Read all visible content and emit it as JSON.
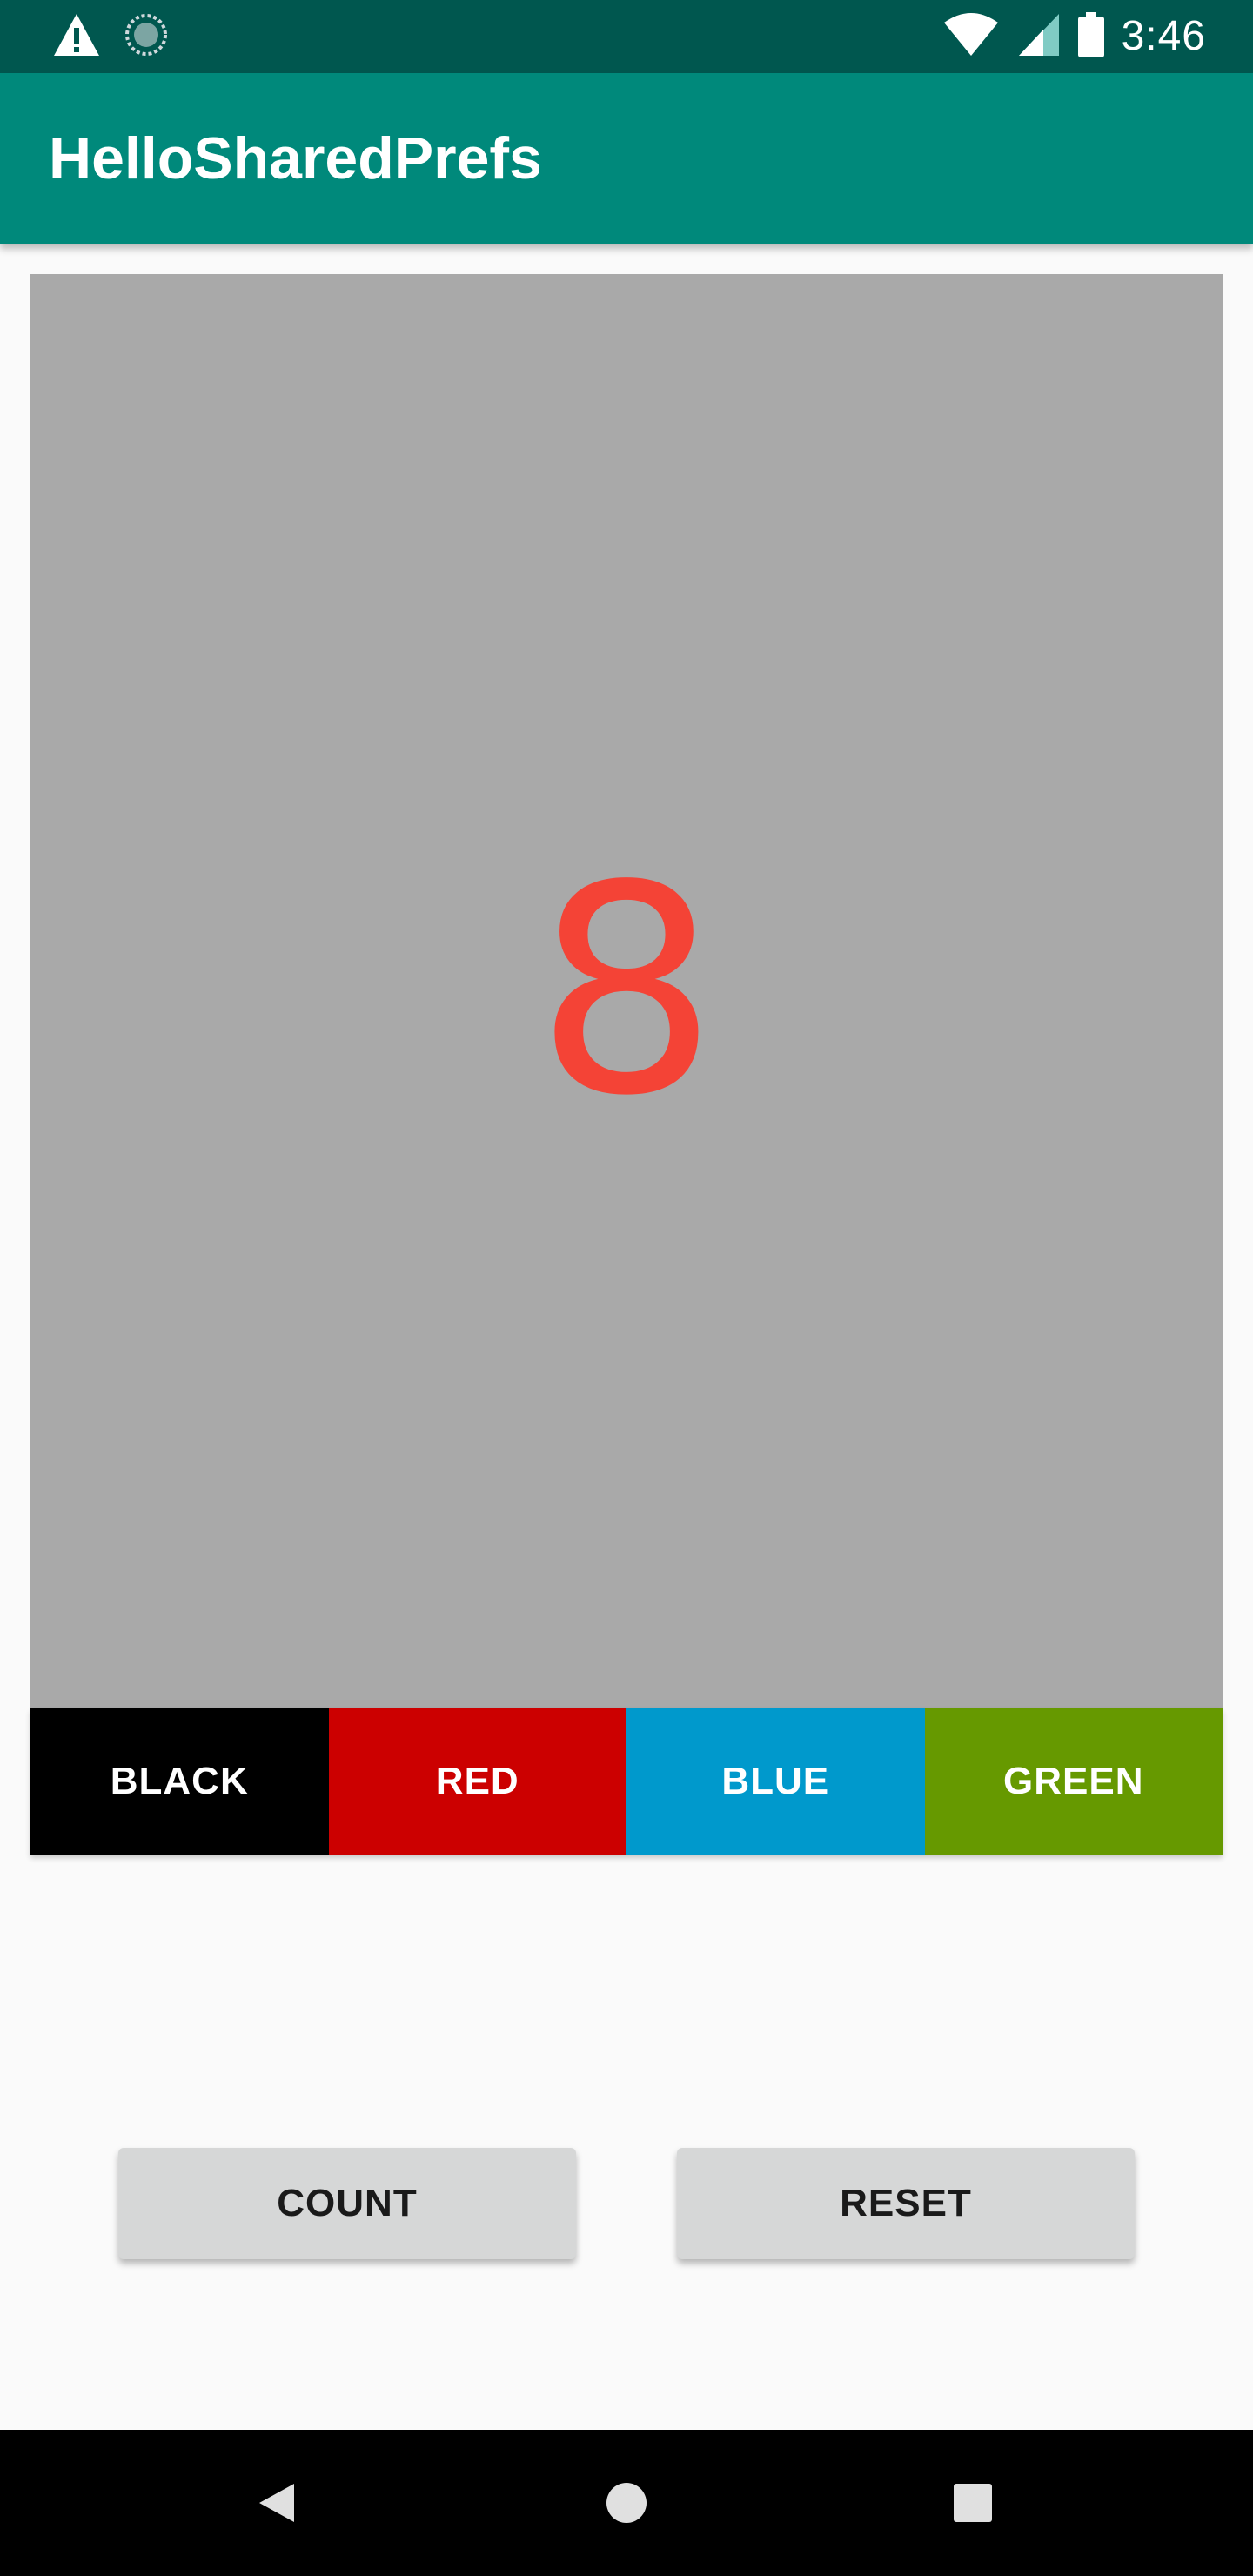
{
  "status_bar": {
    "time": "3:46",
    "icons": [
      "warning-icon",
      "sync-icon",
      "wifi-icon",
      "signal-icon",
      "battery-icon"
    ]
  },
  "app_bar": {
    "title": "HelloSharedPrefs",
    "color": "#00897b"
  },
  "panel": {
    "count": "8",
    "background": "#a9a9a9",
    "text_color": "#f44336"
  },
  "color_buttons": [
    {
      "label": "BLACK",
      "color": "#000000"
    },
    {
      "label": "RED",
      "color": "#cc0000"
    },
    {
      "label": "BLUE",
      "color": "#0099cc"
    },
    {
      "label": "GREEN",
      "color": "#669900"
    }
  ],
  "actions": {
    "count_label": "COUNT",
    "reset_label": "RESET"
  },
  "nav_bar": {
    "icons": [
      "back-icon",
      "home-icon",
      "recents-icon"
    ]
  }
}
